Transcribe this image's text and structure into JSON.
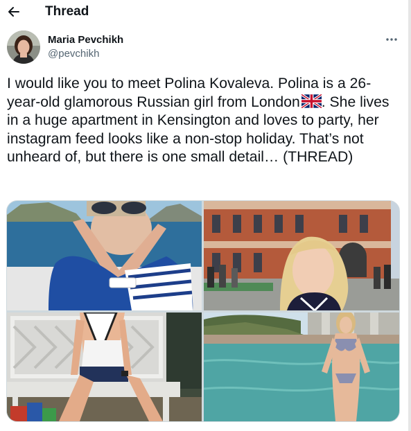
{
  "header": {
    "title": "Thread",
    "back_icon": "arrow-left-icon"
  },
  "author": {
    "name": "Maria Pevchikh",
    "handle": "@pevchikh"
  },
  "tweet": {
    "before_flag": "I would like you to meet Polina Kovaleva. Polina is a 26-year-old glamorous Russian girl from London",
    "flag_icon": "uk-flag-icon",
    "after_flag": ". She lives in a huge apartment in Kensington and loves to party, her instagram feed looks like a non-stop holiday. That’s not unheard of, but there is one small detail… (THREAD)"
  },
  "media": {
    "photo_count": 4,
    "photos": [
      "boat-selfie-photo",
      "street-portrait-photo",
      "bench-photo",
      "pool-photo"
    ]
  },
  "colors": {
    "text": "#0f1419",
    "secondary": "#536471",
    "border": "#cfd9de"
  }
}
